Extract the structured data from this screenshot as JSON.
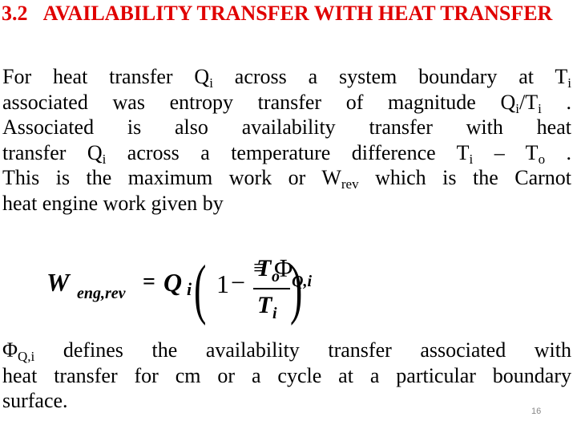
{
  "slide": {
    "title": {
      "number": "3.2",
      "text": "AVAILABILITY TRANSFER WITH HEAT TRANSFER",
      "color": "#e00000"
    },
    "paragraph1": {
      "line1": {
        "a": "For heat transfer Q",
        "a_sub": "i",
        "b": " across a system boundary at T",
        "b_sub": "i"
      },
      "line2": {
        "a": "associated was entropy transfer of magnitude Q",
        "a_sub": "i",
        "b": "/T",
        "b_sub": "i",
        "c": " ."
      },
      "line3": {
        "a": "Associated is also availability transfer with heat"
      },
      "line4": {
        "a": "transfer Q",
        "a_sub": "i",
        "b": " across a temperature difference T",
        "b_sub": "i",
        "c": " – T",
        "c_sub": "o",
        "d": " ."
      },
      "line5": {
        "a": "This is the maximum work or W",
        "a_sub": "rev",
        "b": " which is the Carnot"
      },
      "line6": {
        "a": "heat engine work given by"
      }
    },
    "equation": {
      "lhs": "W",
      "lhs_sub": "eng,rev",
      "equals": "=",
      "q": "Q",
      "q_sub": "i",
      "lparen": "(",
      "one": "1",
      "minus": "−",
      "num": "T",
      "num_sub": "o",
      "den": "T",
      "den_sub": "i",
      "rparen": ")",
      "equiv": "≡",
      "phi": "Φ",
      "phi_sub": "Q,i"
    },
    "paragraph2": {
      "line1": {
        "phi": "Φ",
        "phi_sub": "Q,i",
        "a": " defines the availability transfer associated with"
      },
      "line2": {
        "a": "heat transfer for cm or a cycle at a particular boundary"
      },
      "line3": {
        "a": "surface."
      }
    },
    "page_number": "16"
  }
}
